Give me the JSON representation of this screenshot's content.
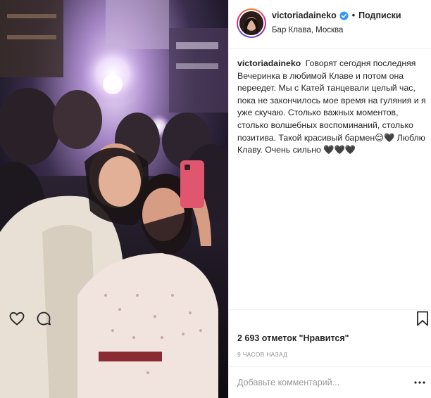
{
  "post": {
    "username": "victoriadaineko",
    "follow_label": "Подписки",
    "separator": "•",
    "location": "Бар Клава, Москва",
    "caption_username": "victoriadaineko",
    "caption_text": "Говорят сегодня последняя Вечеринка в любимой Клаве и потом она переедет. Мы с Катей танцевали целый час, пока не закончилось мое время на гуляния и я уже скучаю. Столько важных моментов, столько волшебных воспоминаний, столько позитива. Такой красивый бармен😌🖤 Люблю Клаву. Очень сильно 🖤🖤🖤",
    "likes": "2 693 отметок \"Нравится\"",
    "time_ago": "9 ЧАСОВ НАЗАД",
    "comment_placeholder": "Добавьте комментарий...",
    "more_label": "..."
  },
  "icons": {
    "verified": "verified-badge-icon",
    "like": "heart-icon",
    "comment": "comment-bubble-icon",
    "save": "bookmark-icon",
    "more": "ellipsis-icon"
  },
  "colors": {
    "verified": "#3897f0",
    "text": "#262626",
    "muted": "#8e8e8e",
    "border": "#efefef"
  }
}
